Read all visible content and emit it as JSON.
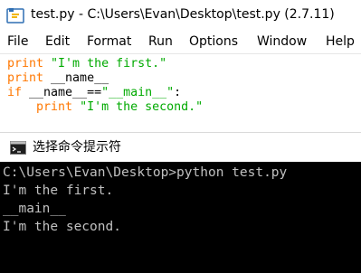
{
  "idle": {
    "title": "test.py - C:\\Users\\Evan\\Desktop\\test.py (2.7.11)",
    "icon": "python-idle-icon",
    "menu": [
      "File",
      "Edit",
      "Format",
      "Run",
      "Options",
      "Window",
      "Help"
    ],
    "code": {
      "line1": {
        "kw": "print",
        "str": " \"I'm the first.\""
      },
      "line2": {
        "kw": "print",
        "rest": " __name__"
      },
      "line3": {
        "kw": "if",
        "rest": " __name__==",
        "str": "\"__main__\"",
        "tail": ":"
      },
      "line4": {
        "indent": "    ",
        "kw": "print",
        "str": " \"I'm the second.\""
      }
    },
    "colors": {
      "keyword": "#ff7700",
      "string": "#00aa00",
      "text": "#000000"
    }
  },
  "cmd": {
    "title": "选择命令提示符",
    "icon": "command-prompt-icon",
    "lines": [
      "C:\\Users\\Evan\\Desktop>python test.py",
      "I'm the first.",
      "__main__",
      "I'm the second."
    ],
    "colors": {
      "background": "#000000",
      "text": "#c0c0c0"
    }
  }
}
